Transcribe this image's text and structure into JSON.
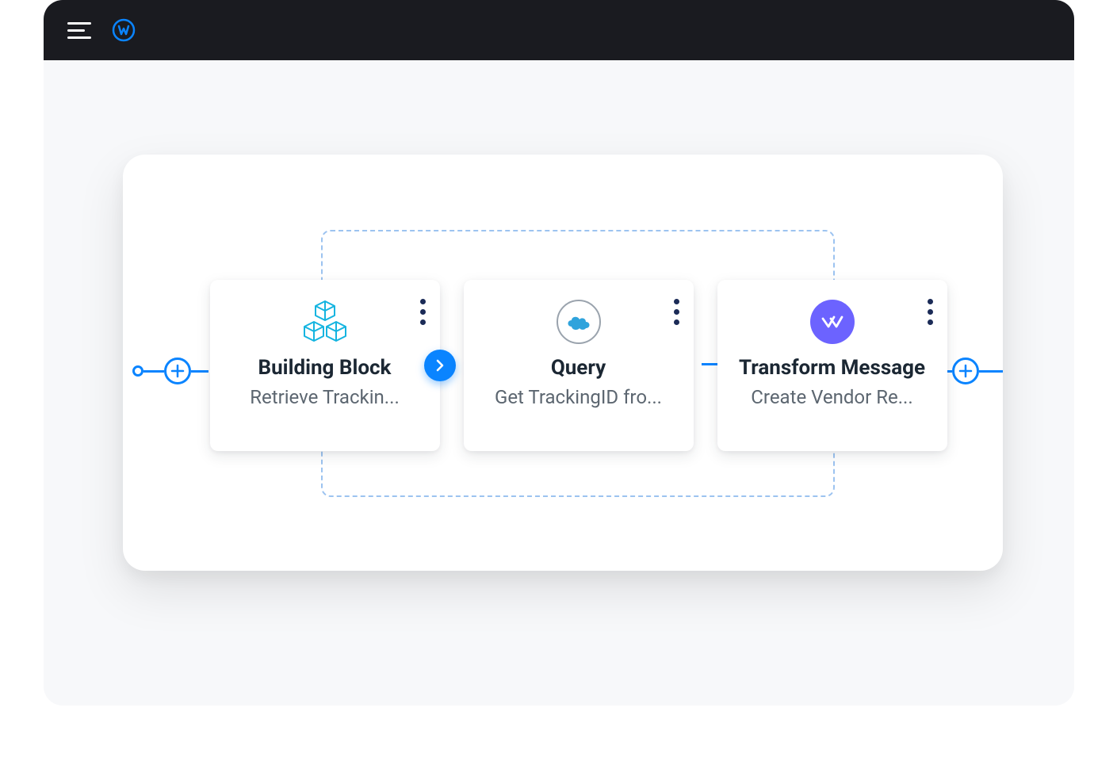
{
  "header": {
    "logo_name": "mulesoft-logo"
  },
  "flow": {
    "cards": [
      {
        "title": "Building Block",
        "subtitle": "Retrieve Trackin...",
        "icon": "building-block",
        "has_next": true
      },
      {
        "title": "Query",
        "subtitle": "Get TrackingID fro...",
        "icon": "salesforce",
        "has_next": false
      },
      {
        "title": "Transform Message",
        "subtitle": "Create Vendor Re...",
        "icon": "transform",
        "has_next": false
      }
    ]
  },
  "colors": {
    "accent": "#0a84ff",
    "header_bg": "#1a1b20",
    "canvas_bg": "#f7f8fa",
    "card_text": "#1b2733",
    "card_sub": "#5c6670",
    "transform_bg": "#6c63ff",
    "dashed": "#9cc3f0"
  }
}
